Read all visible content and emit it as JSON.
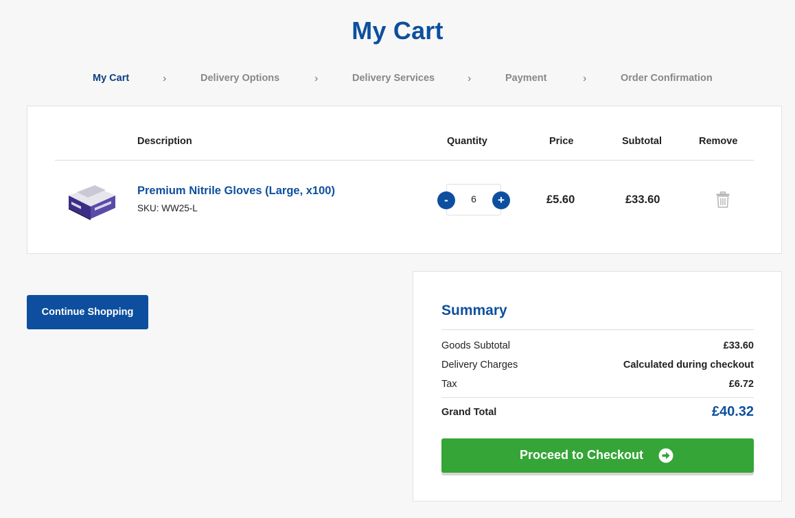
{
  "page_title": "My Cart",
  "steps": [
    {
      "label": "My Cart",
      "active": true
    },
    {
      "label": "Delivery Options",
      "active": false
    },
    {
      "label": "Delivery Services",
      "active": false
    },
    {
      "label": "Payment",
      "active": false
    },
    {
      "label": "Order Confirmation",
      "active": false
    }
  ],
  "step_separator": "›",
  "cart": {
    "headers": {
      "description": "Description",
      "quantity": "Quantity",
      "price": "Price",
      "subtotal": "Subtotal",
      "remove": "Remove"
    },
    "items": [
      {
        "name": "Premium Nitrile Gloves (Large, x100)",
        "sku": "SKU: WW25-L",
        "quantity": "6",
        "price": "£5.60",
        "subtotal": "£33.60",
        "thumbnail_icon": "glove-box-image",
        "remove_icon": "trash-icon"
      }
    ],
    "qty_minus": "-",
    "qty_plus": "+"
  },
  "continue_shopping_label": "Continue Shopping",
  "summary": {
    "title": "Summary",
    "rows": [
      {
        "label": "Goods Subtotal",
        "value": "£33.60"
      },
      {
        "label": "Delivery Charges",
        "value": "Calculated during checkout"
      },
      {
        "label": "Tax",
        "value": "£6.72"
      }
    ],
    "grand_total_label": "Grand Total",
    "grand_total_value": "£40.32",
    "checkout_label": "Proceed to Checkout",
    "checkout_icon": "arrow-circle-right-icon"
  },
  "colors": {
    "brand_blue": "#0d4f9e",
    "checkout_green": "#34a536",
    "background": "#f7f7f7"
  }
}
